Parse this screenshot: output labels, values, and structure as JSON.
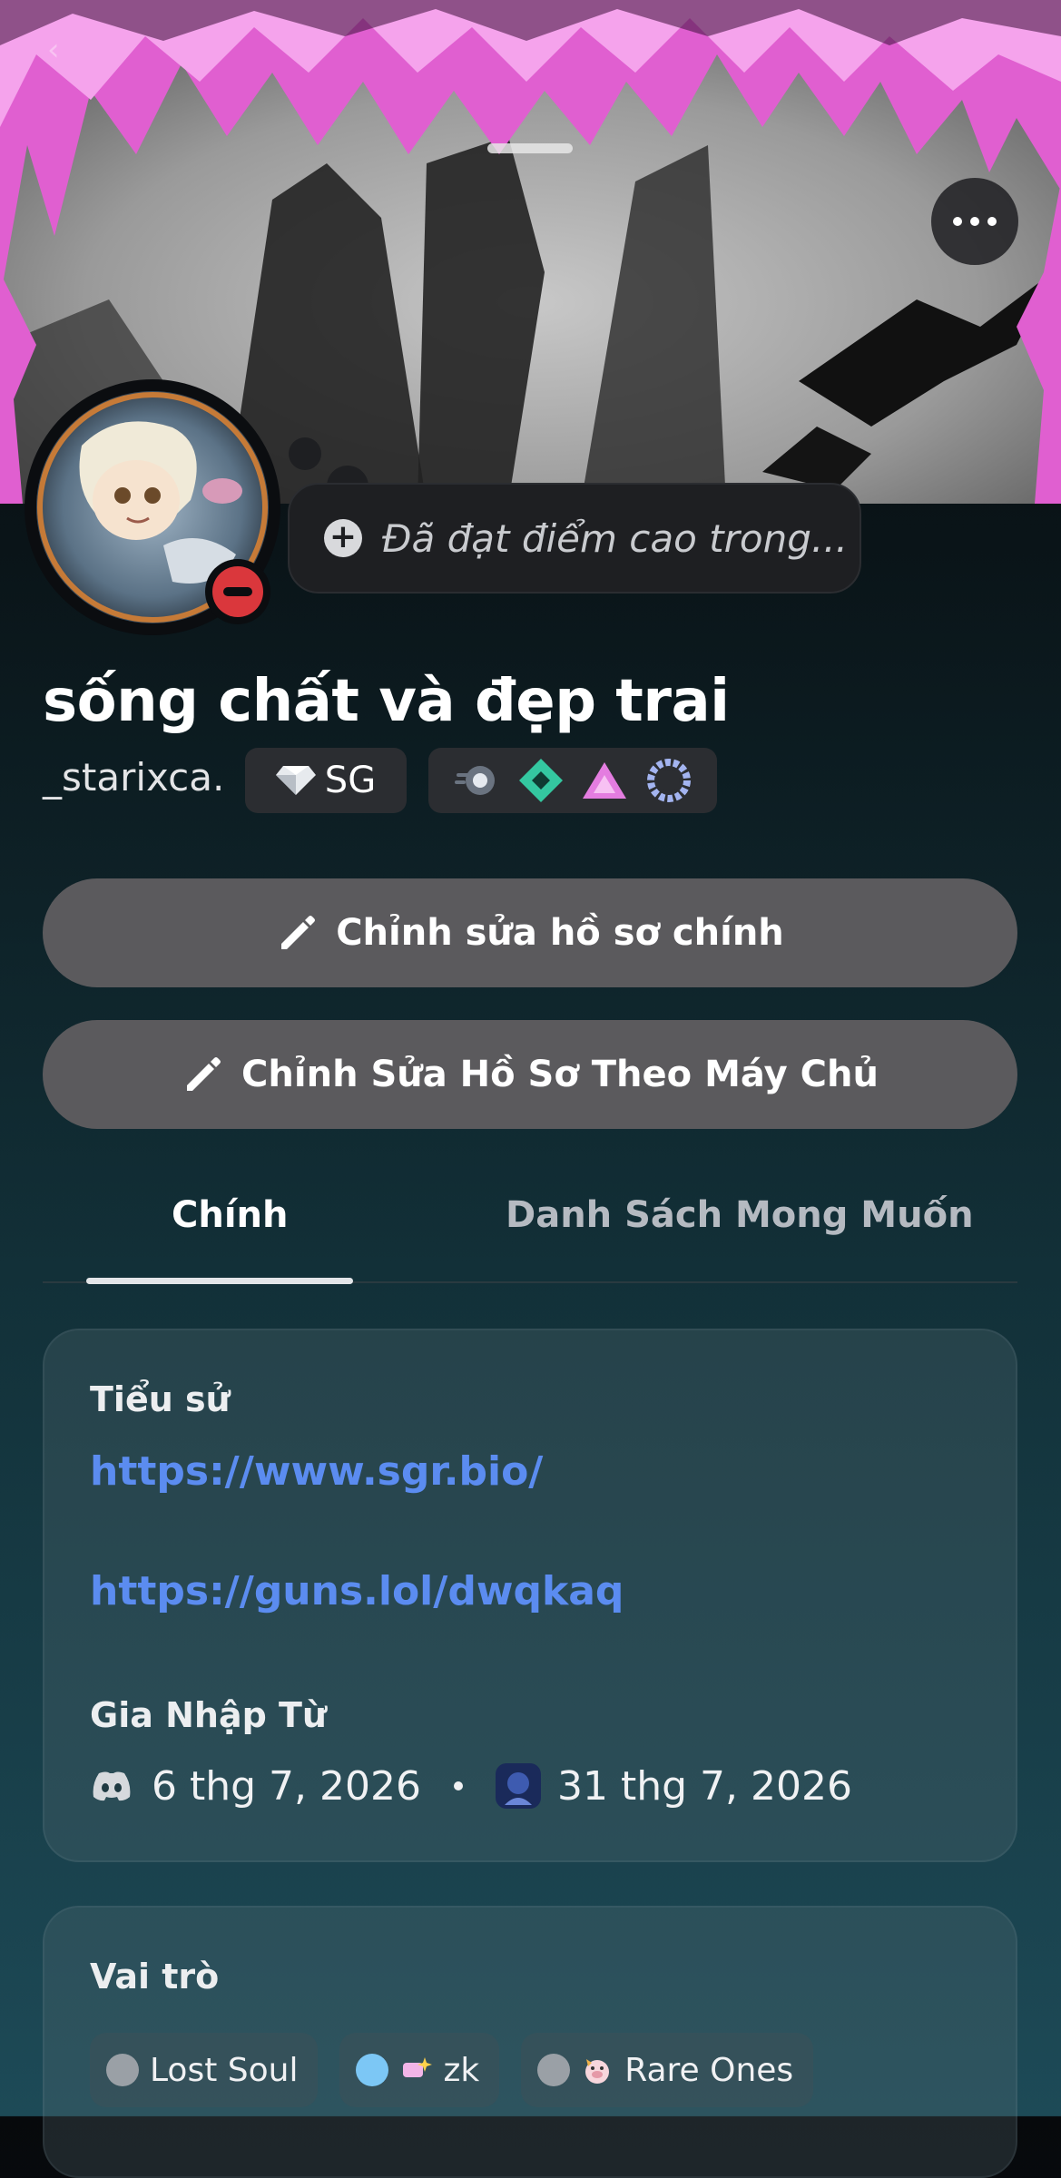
{
  "profile": {
    "display_name": "sống chất và đẹp trai",
    "username": "_starixca.",
    "server_tag": "SG",
    "custom_status_placeholder": "Đã đạt điểm cao trong...",
    "status": "do-not-disturb"
  },
  "buttons": {
    "edit_main_profile": "Chỉnh sửa hồ sơ chính",
    "edit_server_profile": "Chỉnh Sửa Hồ Sơ Theo Máy Chủ"
  },
  "tabs": [
    {
      "label": "Chính",
      "active": true
    },
    {
      "label": "Danh Sách Mong Muốn",
      "active": false
    }
  ],
  "about": {
    "heading": "Tiểu sử",
    "links": [
      "https://www.sgr.bio/",
      "https://guns.lol/dwqkaq"
    ]
  },
  "member_since": {
    "heading": "Gia Nhập Từ",
    "discord_date": "6 thg 7, 2026",
    "server_date": "31 thg 7, 2026"
  },
  "roles": {
    "heading": "Vai trò",
    "items": [
      {
        "name": "Lost Soul",
        "color": "#9aa0a6"
      },
      {
        "name": "zk",
        "color": "#7cc7f5"
      },
      {
        "name": "Rare Ones",
        "color": "#9aa0a6"
      }
    ]
  },
  "colors": {
    "link": "#5b8cf0",
    "button": "#5b5a5d",
    "dnd_status": "#da373c"
  }
}
